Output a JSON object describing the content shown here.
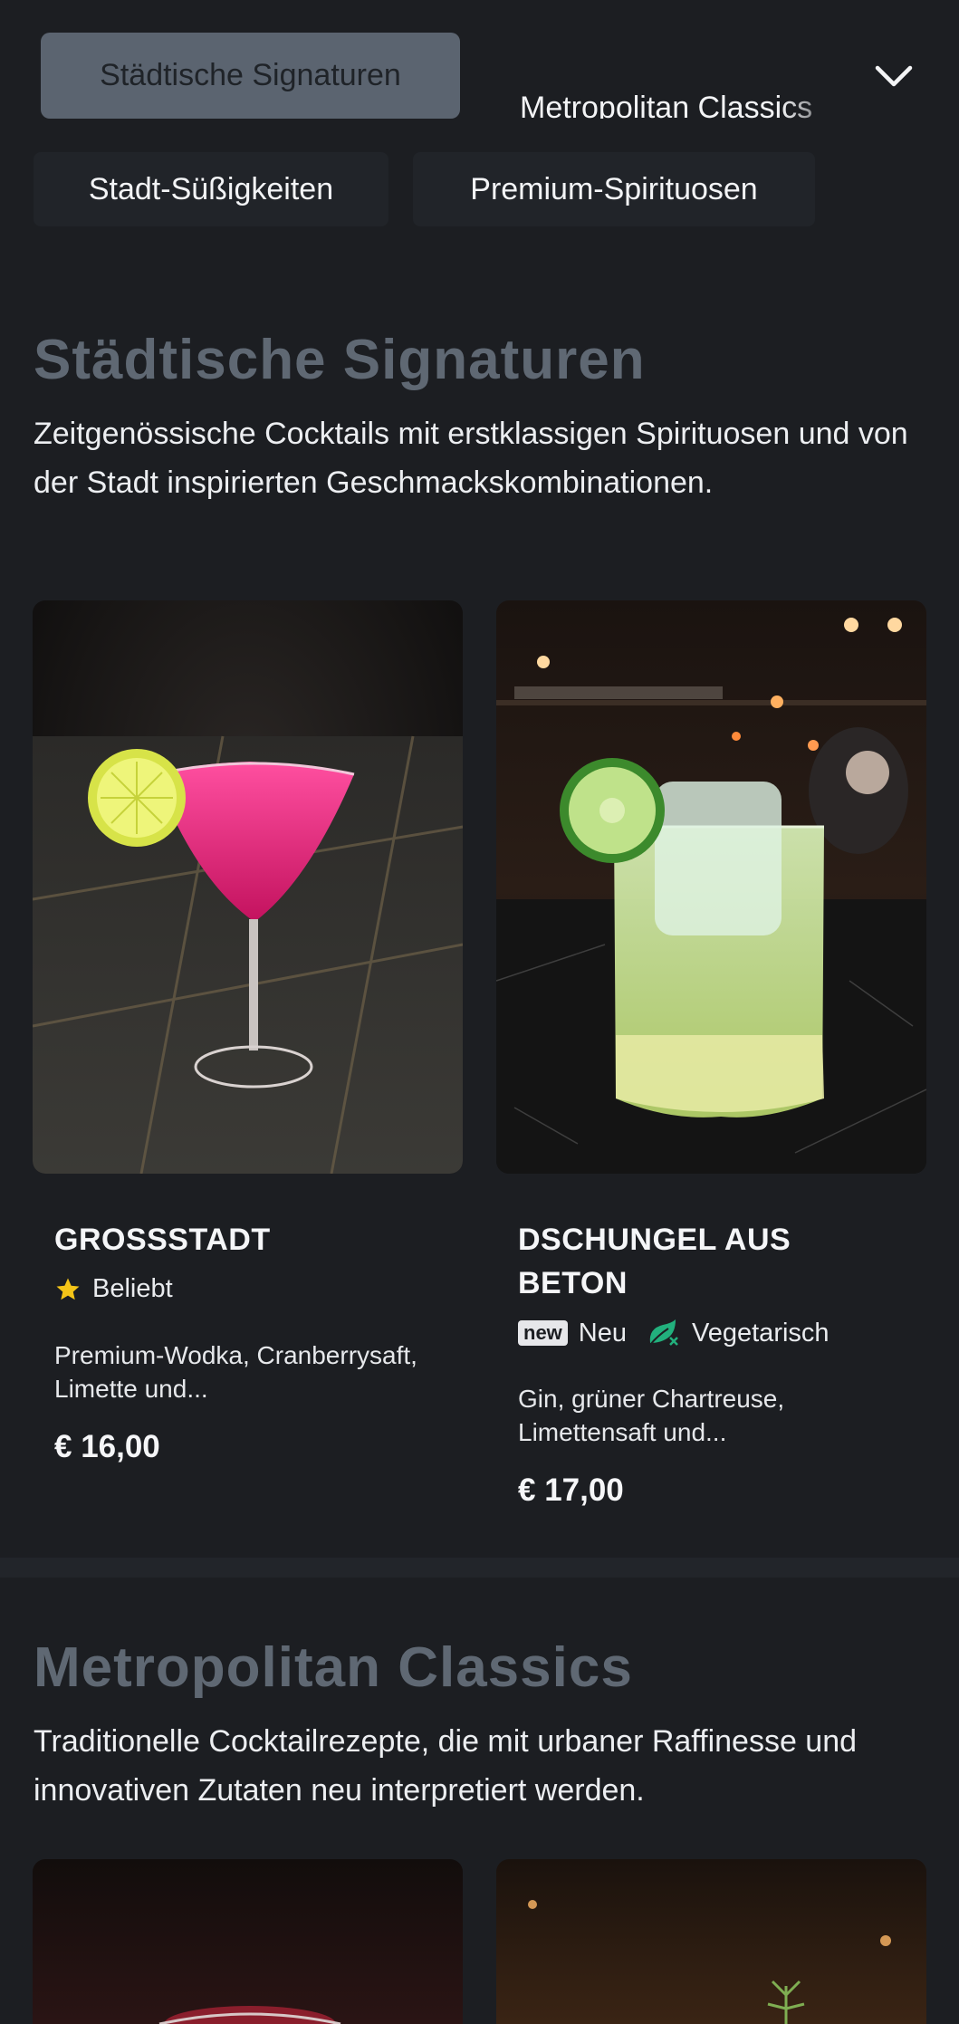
{
  "nav": {
    "tabs": [
      "Städtische Signaturen",
      "Metropolitan Classics"
    ],
    "chips": [
      "Stadt-Süßigkeiten",
      "Premium-Spirituosen"
    ]
  },
  "sections": [
    {
      "title": "Städtische Signaturen",
      "description": "Zeitgenössische Cocktails mit erstklassigen Spirituosen und von der Stadt inspirierten Geschmackskombinationen.",
      "items": [
        {
          "name": "GROSSSTADT",
          "tags": [
            {
              "icon": "star-icon",
              "label": "Beliebt"
            }
          ],
          "description": "Premium-Wodka, Cranberrysaft, Limette und...",
          "price": "€ 16,00"
        },
        {
          "name": "DSCHUNGEL AUS BETON",
          "tags": [
            {
              "icon": "new-badge",
              "badge_text": "new",
              "label": "Neu"
            },
            {
              "icon": "vegetarian-icon",
              "label": "Vegetarisch"
            }
          ],
          "description": "Gin, grüner Chartreuse, Limettensaft und...",
          "price": "€ 17,00"
        }
      ]
    },
    {
      "title": "Metropolitan Classics",
      "description": "Traditionelle Cocktailrezepte, die mit urbaner Raffinesse und innovativen Zutaten neu interpretiert werden."
    }
  ],
  "colors": {
    "background": "#1c1e22",
    "active_tab": "#5b6470",
    "section_title": "#5f6873",
    "star": "#f5c518",
    "vegetarian": "#22b07d"
  }
}
